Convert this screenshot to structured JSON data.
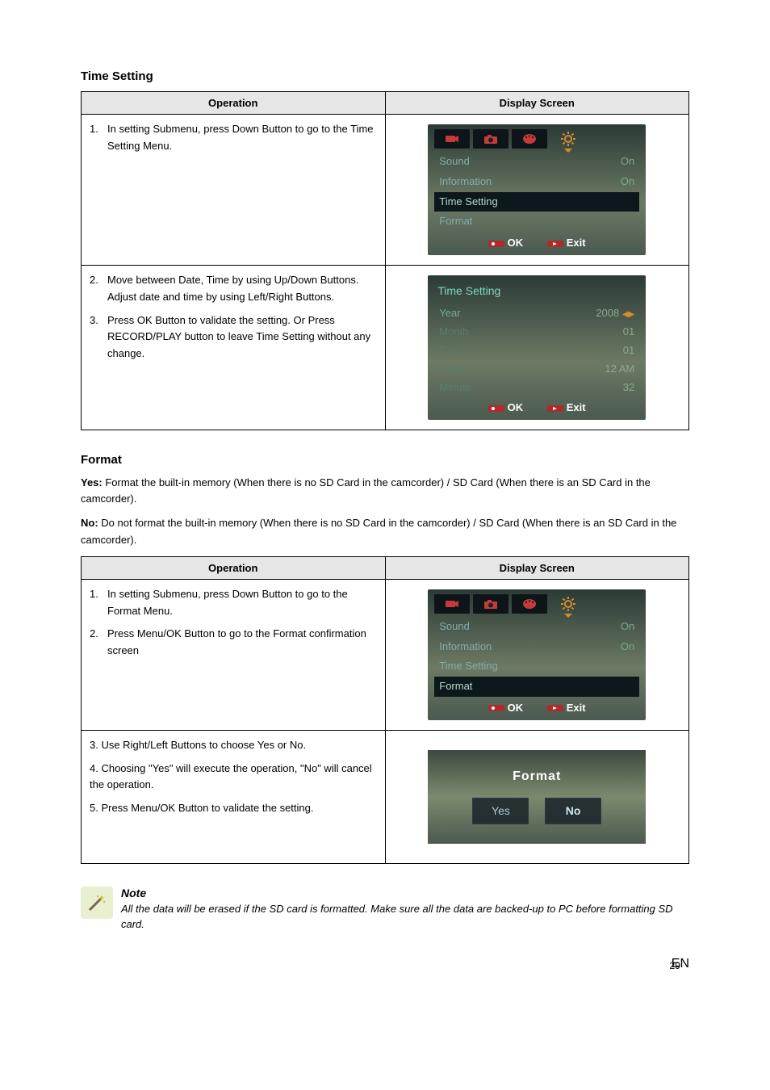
{
  "sections": {
    "time_setting_heading": "Time Setting",
    "format_heading": "Format"
  },
  "table_headers": {
    "operation": "Operation",
    "display_screen": "Display Screen"
  },
  "time_table": {
    "row1": {
      "num": "1.",
      "text": "In setting Submenu, press Down Button to go to the Time Setting Menu."
    },
    "row2a": {
      "num": "2.",
      "text": "Move between Date, Time by using Up/Down Buttons. Adjust date and time by using Left/Right Buttons."
    },
    "row2b": {
      "num": "3.",
      "text": "Press OK Button to validate the setting. Or Press RECORD/PLAY button to leave Time Setting without any change."
    }
  },
  "format_intro": {
    "yes_label": "Yes:",
    "yes_text": " Format the built-in memory (When there is no SD Card in the camcorder) / SD Card (When there is an SD Card in the camcorder).",
    "no_label": "No:",
    "no_text": " Do not format the built-in memory (When there is no SD Card in the camcorder) / SD Card (When there is an SD Card in the camcorder)."
  },
  "format_table": {
    "row1a": {
      "num": "1.",
      "text": "In setting Submenu, press Down Button to go to the Format Menu."
    },
    "row1b": {
      "num": "2.",
      "text": "Press Menu/OK Button to go to the Format confirmation screen"
    },
    "row2a": {
      "text": "3. Use Right/Left Buttons to choose Yes or No."
    },
    "row2b": {
      "text": "4. Choosing \"Yes\" will execute the operation, \"No\" will cancel the operation."
    },
    "row2c": {
      "text": "5. Press Menu/OK Button to validate the setting."
    }
  },
  "device_menu": {
    "sound": "Sound",
    "information": "Information",
    "time_setting": "Time Setting",
    "format": "Format",
    "on": "On",
    "ok": "OK",
    "exit": "Exit"
  },
  "time_screen": {
    "title": "Time  Setting",
    "year": "Year",
    "year_v": "2008",
    "month": "Month",
    "month_v": "01",
    "day": "Day",
    "day_v": "01",
    "hour": "Hour",
    "hour_v": "12 AM",
    "minute": "Minute",
    "minute_v": "32"
  },
  "format_dialog": {
    "title": "Format",
    "yes": "Yes",
    "no": "No"
  },
  "note": {
    "heading": "Note",
    "text": "All the data will be erased if the SD card is formatted. Make sure all the data are backed-up to PC before formatting SD card."
  },
  "footer": {
    "page": "29",
    "lang": "EN"
  },
  "icons": {
    "movie": "movie-icon",
    "camera": "camera-icon",
    "palette": "palette-icon",
    "gear": "gear-icon",
    "rec": "rec-icon",
    "play": "play-icon",
    "wand": "wand-icon"
  }
}
